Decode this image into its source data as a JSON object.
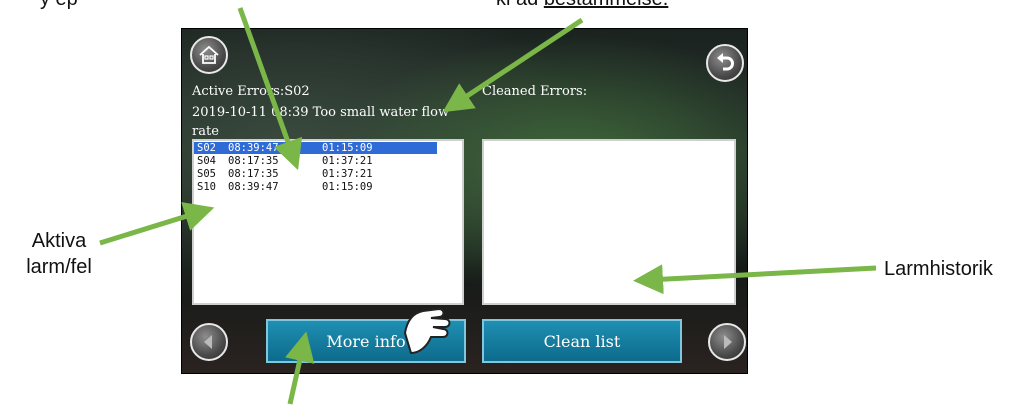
{
  "annotations": {
    "top_left_prefix": "y       ep",
    "top_right_text": "kl ad ",
    "top_right_underlined": "bestämmelse.",
    "aktiva_line1": "Aktiva",
    "aktiva_line2": "larm/fel",
    "larmhistorik": "Larmhistorik"
  },
  "screen": {
    "active_errors_label": "Active Errors:S02",
    "active_error_message": "2019-10-11 08:39 Too small water flow rate",
    "cleaned_errors_label": "Cleaned Errors:",
    "error_rows": [
      {
        "code": "S02",
        "time": "08:39:47",
        "duration": "01:15:09"
      },
      {
        "code": "S04",
        "time": "08:17:35",
        "duration": "01:37:21"
      },
      {
        "code": "S05",
        "time": "08:17:35",
        "duration": "01:37:21"
      },
      {
        "code": "S10",
        "time": "08:39:47",
        "duration": "01:15:09"
      }
    ],
    "more_button": "More info",
    "clean_button": "Clean list"
  },
  "colors": {
    "arrow": "#7ab648",
    "button": "#0d6b8c",
    "selection": "#2f6bd6"
  },
  "icons": [
    "home-icon",
    "undo-icon",
    "arrow-left-icon",
    "arrow-right-icon",
    "hand-pointer-icon"
  ]
}
